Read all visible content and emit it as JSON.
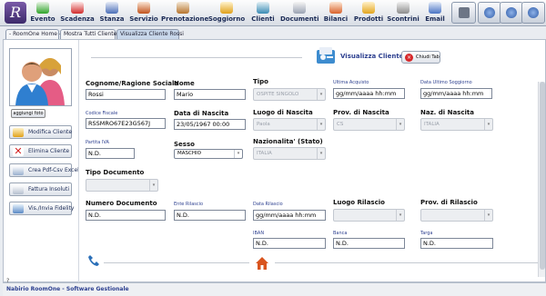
{
  "toolbar": {
    "items": [
      {
        "label": "Evento",
        "icon": "calendar-plus-icon"
      },
      {
        "label": "Scadenza",
        "icon": "flag-icon"
      },
      {
        "label": "Stanza",
        "icon": "room-icon"
      },
      {
        "label": "Servizio",
        "icon": "service-icon"
      },
      {
        "label": "Prenotazione",
        "icon": "booking-icon"
      },
      {
        "label": "Soggiorno",
        "icon": "stay-icon"
      },
      {
        "label": "Clienti",
        "icon": "clients-icon"
      },
      {
        "label": "Documenti",
        "icon": "documents-icon"
      },
      {
        "label": "Bilanci",
        "icon": "balance-icon"
      },
      {
        "label": "Prodotti",
        "icon": "products-icon"
      },
      {
        "label": "Scontrini",
        "icon": "receipt-icon"
      },
      {
        "label": "Email",
        "icon": "email-icon"
      }
    ]
  },
  "tabs": [
    "- RoomOne Home -",
    "Mostra Tutti Cliente",
    "Visualizza Cliente Rossi"
  ],
  "sidebar": {
    "photo_button": "aggiungi foto",
    "actions": [
      "Modifica Cliente",
      "Elimina Cliente",
      "Crea Pdf-Csv Excel",
      "Fattura Insoluti",
      "Vis./Invia Fidelity"
    ]
  },
  "header": {
    "title": "Visualizza Cliente",
    "close_label": "Chiudi Tab"
  },
  "form": {
    "cognome": {
      "label": "Cognome/Ragione Sociale",
      "value": "Rossi"
    },
    "nome": {
      "label": "Nome",
      "value": "Mario"
    },
    "tipo": {
      "label": "Tipo",
      "value": "OSPITE SINGOLO"
    },
    "ultima_acquisto": {
      "label": "Ultima Acquisto",
      "value": "gg/mm/aaaa hh:mm"
    },
    "data_ultimo_soggiorno": {
      "label": "Data Ultimo Soggiorno",
      "value": "gg/mm/aaaa hh:mm"
    },
    "codice_fiscale": {
      "label": "Codice Fiscale",
      "value": "RSSMRO67E23G567J"
    },
    "data_nascita": {
      "label": "Data di Nascita",
      "value": "23/05/1967 00:00"
    },
    "luogo_nascita": {
      "label": "Luogo di Nascita",
      "value": "Paola"
    },
    "prov_nascita": {
      "label": "Prov. di Nascita",
      "value": "CS"
    },
    "naz_nascita": {
      "label": "Naz. di Nascita",
      "value": "ITALIA"
    },
    "partita_iva": {
      "label": "Partita IVA",
      "value": "N.D."
    },
    "sesso": {
      "label": "Sesso",
      "value": "MASCHIO"
    },
    "nazionalita": {
      "label": "Nazionalita' (Stato)",
      "value": "ITALIA"
    },
    "tipo_documento": {
      "label": "Tipo Documento",
      "value": ""
    },
    "numero_documento": {
      "label": "Numero Documento",
      "value": "N.D."
    },
    "ente_rilascio": {
      "label": "Ente Rilascio",
      "value": "N.D."
    },
    "data_rilascio": {
      "label": "Data Rilascio",
      "value": "gg/mm/aaaa hh:mm"
    },
    "luogo_rilascio": {
      "label": "Luogo Rilascio",
      "value": ""
    },
    "prov_rilascio": {
      "label": "Prov. di Rilascio",
      "value": ""
    },
    "iban": {
      "label": "IBAN",
      "value": "N.D."
    },
    "banca": {
      "label": "Banca",
      "value": "N.D."
    },
    "targa": {
      "label": "Targa",
      "value": "N.D."
    }
  },
  "footer": {
    "help": "?",
    "text": "Nabirio RoomOne - Software Gestionale"
  },
  "colors": {
    "accent": "#2c3f8f",
    "header_bg": "#d8dde5"
  }
}
